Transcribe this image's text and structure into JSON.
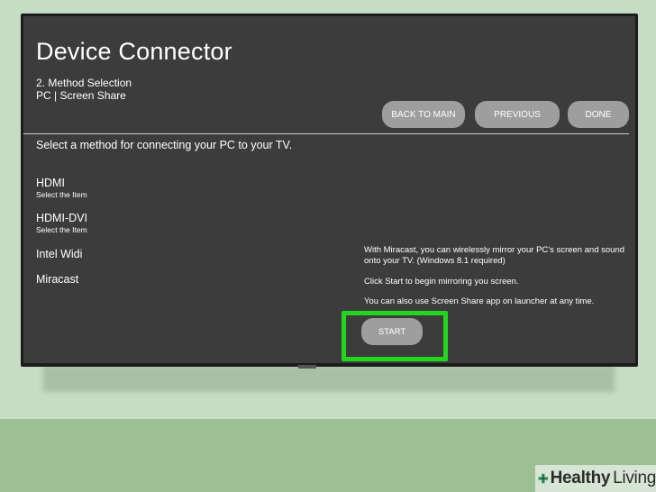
{
  "screen": {
    "title": "Device Connector",
    "step": "2. Method Selection",
    "context": "PC | Screen Share",
    "buttons": {
      "back": "BACK TO MAIN",
      "previous": "PREVIOUS",
      "done": "DONE"
    },
    "prompt": "Select a method for connecting your PC to your TV.",
    "methods": [
      {
        "name": "HDMI",
        "hint": "Select the Item"
      },
      {
        "name": "HDMI-DVI",
        "hint": "Select the Item"
      },
      {
        "name": "Intel Widi"
      },
      {
        "name": "Miracast"
      }
    ],
    "info": [
      "With Miracast, you can wirelessly mirror your PC's screen and sound onto your TV. (Windows 8.1 required)",
      "Click Start to begin mirroring you screen.",
      "You can also use Screen Share app on launcher at any time."
    ],
    "start_label": "START"
  },
  "logo": {
    "word1": "Healthy",
    "word2": "Living"
  },
  "colors": {
    "screen_bg": "#3c3c3c",
    "button_bg": "#9e9e9e",
    "highlight": "#22d61f",
    "background": "#c6dcc4",
    "floor": "#9cc093"
  }
}
